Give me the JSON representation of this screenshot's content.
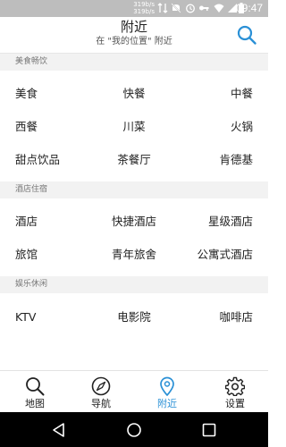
{
  "status_bar": {
    "speed_up": "319b/s",
    "speed_down": "319b/s",
    "time": "09:47",
    "icons": [
      "data-arrows-icon",
      "mute-icon",
      "alarm-icon",
      "key-icon",
      "wifi-icon",
      "signal-icon",
      "battery-icon"
    ]
  },
  "header": {
    "title": "附近",
    "subtitle": "在 \"我的位置\" 附近",
    "search_icon": "search-icon",
    "accent_color": "#2a90d6"
  },
  "sections": [
    {
      "label": "美食畅饮",
      "rows": [
        [
          "美食",
          "快餐",
          "中餐"
        ],
        [
          "西餐",
          "川菜",
          "火锅"
        ],
        [
          "甜点饮品",
          "茶餐厅",
          "肯德基"
        ]
      ]
    },
    {
      "label": "酒店住宿",
      "rows": [
        [
          "酒店",
          "快捷酒店",
          "星级酒店"
        ],
        [
          "旅馆",
          "青年旅舍",
          "公寓式酒店"
        ]
      ]
    },
    {
      "label": "娱乐休闲",
      "rows": [
        [
          "KTV",
          "电影院",
          "咖啡店"
        ]
      ]
    }
  ],
  "tabbar": {
    "tabs": [
      {
        "label": "地图",
        "icon": "search-icon"
      },
      {
        "label": "导航",
        "icon": "compass-icon"
      },
      {
        "label": "附近",
        "icon": "location-pin-icon",
        "active": true
      },
      {
        "label": "设置",
        "icon": "gear-icon"
      }
    ]
  },
  "navbar": {
    "icons": [
      "back-icon",
      "home-icon",
      "recents-icon"
    ]
  }
}
